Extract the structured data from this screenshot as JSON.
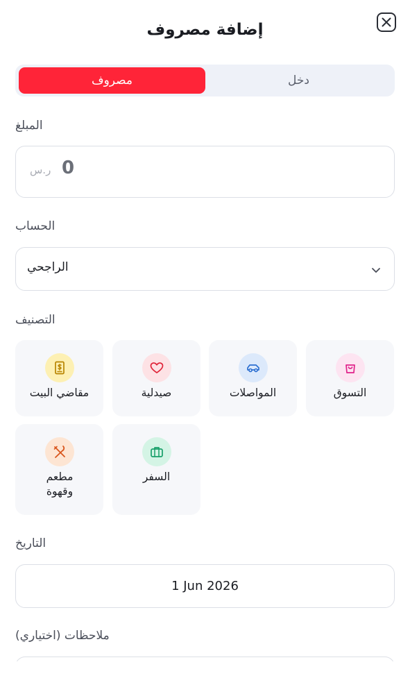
{
  "header": {
    "title": "إضافة مصروف"
  },
  "type_toggle": {
    "expense_label": "مصروف",
    "income_label": "دخل",
    "selected": "expense",
    "accent_color": "#ff2438"
  },
  "amount": {
    "label": "المبلغ",
    "value": "0",
    "currency": "ر.س"
  },
  "account": {
    "label": "الحساب",
    "selected": "الراجحي"
  },
  "category": {
    "label": "التصنيف",
    "items": [
      {
        "label": "التسوق",
        "icon": "shopping-bag-icon",
        "color": "#e0218a",
        "bg": "#fde4f1"
      },
      {
        "label": "المواصلات",
        "icon": "car-icon",
        "color": "#2c6fd1",
        "bg": "#dce9fb"
      },
      {
        "label": "صيدلية",
        "icon": "heart-icon",
        "color": "#e02439",
        "bg": "#fde2e5"
      },
      {
        "label": "مقاضي البيت",
        "icon": "receipt-icon",
        "color": "#b88400",
        "bg": "#fdf0b3"
      },
      {
        "label": "السفر",
        "icon": "suitcase-icon",
        "color": "#18a06a",
        "bg": "#d4f4e5"
      },
      {
        "label": "مطعم وقهوة",
        "icon": "utensils-icon",
        "color": "#d9561d",
        "bg": "#fde5d3"
      }
    ]
  },
  "date": {
    "label": "التاريخ",
    "value": "1 Jun 2026"
  },
  "notes": {
    "label": "ملاحظات (اختياري)"
  }
}
